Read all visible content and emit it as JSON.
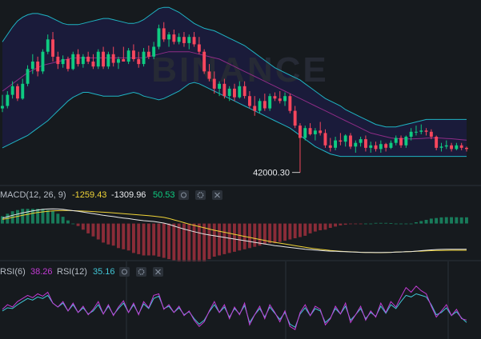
{
  "colors": {
    "background": "#161a1e",
    "up": "#0ecb81",
    "down": "#f6465d",
    "band": "#1fb4c3",
    "band_fill": "#1a1b3a",
    "band_mid": "#8e2c86",
    "macd_line": "#e8e8e8",
    "signal_line": "#f0d437",
    "rsi6": "#c23bd4",
    "rsi12": "#41c6d6",
    "divider": "#2b3139",
    "watermark": "#2a2d3a"
  },
  "watermark": "BINANCE",
  "price_pane": {
    "low_annotation": "42000.30"
  },
  "macd_pane": {
    "title": "MACD(12, 26, 9)",
    "dif": "-1259.43",
    "dea": "-1309.96",
    "hist": "50.53"
  },
  "rsi_pane": {
    "rsi6_label": "RSI(6)",
    "rsi6_value": "38.26",
    "rsi12_label": "RSI(12)",
    "rsi12_value": "35.16"
  },
  "chart_data": {
    "type": "candlestick",
    "note_units": "price in USDT (estimated)",
    "candles": [
      [
        44600,
        45150,
        44450,
        44700
      ],
      [
        44700,
        45300,
        44600,
        45150
      ],
      [
        45150,
        45700,
        45000,
        45500
      ],
      [
        45500,
        45600,
        44900,
        45000
      ],
      [
        45000,
        45800,
        44950,
        45600
      ],
      [
        45600,
        46350,
        45500,
        46200
      ],
      [
        46200,
        46800,
        46000,
        46500
      ],
      [
        46500,
        46700,
        45900,
        46100
      ],
      [
        46100,
        47000,
        46000,
        46900
      ],
      [
        46900,
        47600,
        46800,
        47400
      ],
      [
        47400,
        47700,
        46500,
        46700
      ],
      [
        46700,
        46900,
        46200,
        46400
      ],
      [
        46400,
        46750,
        46250,
        46600
      ],
      [
        46600,
        46700,
        46100,
        46200
      ],
      [
        46200,
        46900,
        46150,
        46800
      ],
      [
        46800,
        47000,
        46300,
        46400
      ],
      [
        46400,
        46800,
        46250,
        46700
      ],
      [
        46700,
        46900,
        46400,
        46500
      ],
      [
        46500,
        46800,
        46200,
        46300
      ],
      [
        46300,
        47000,
        46200,
        46900
      ],
      [
        46900,
        47100,
        46200,
        46300
      ],
      [
        46300,
        46900,
        46200,
        46800
      ],
      [
        46800,
        47100,
        46300,
        46450
      ],
      [
        46450,
        46700,
        46200,
        46600
      ],
      [
        46600,
        47100,
        46500,
        46500
      ],
      [
        46500,
        47050,
        46400,
        46950
      ],
      [
        46950,
        47200,
        46500,
        46600
      ],
      [
        46600,
        46900,
        46250,
        46400
      ],
      [
        46400,
        47050,
        46300,
        46900
      ],
      [
        46900,
        47150,
        46600,
        46700
      ],
      [
        46700,
        47300,
        46600,
        47100
      ],
      [
        47100,
        48000,
        47000,
        47850
      ],
      [
        47850,
        48100,
        47300,
        47400
      ],
      [
        47400,
        47700,
        47100,
        47600
      ],
      [
        47600,
        47800,
        47200,
        47300
      ],
      [
        47300,
        47650,
        47200,
        47500
      ],
      [
        47500,
        47700,
        47100,
        47250
      ],
      [
        47250,
        47600,
        47000,
        47500
      ],
      [
        47500,
        47700,
        47100,
        47200
      ],
      [
        47200,
        47500,
        46800,
        46900
      ],
      [
        46900,
        47000,
        46000,
        46100
      ],
      [
        46100,
        46400,
        45700,
        45800
      ],
      [
        45800,
        46100,
        45200,
        45400
      ],
      [
        45400,
        45700,
        45100,
        45600
      ],
      [
        45600,
        45800,
        45000,
        45100
      ],
      [
        45100,
        45500,
        44900,
        45400
      ],
      [
        45400,
        45600,
        44900,
        45050
      ],
      [
        45050,
        45700,
        45000,
        45500
      ],
      [
        45500,
        45700,
        45000,
        45100
      ],
      [
        45100,
        45300,
        44600,
        44700
      ],
      [
        44700,
        45100,
        44300,
        44500
      ],
      [
        44500,
        45000,
        44400,
        44900
      ],
      [
        44900,
        45200,
        44500,
        44600
      ],
      [
        44600,
        45200,
        44500,
        45100
      ],
      [
        45100,
        45250,
        44900,
        45000
      ],
      [
        45000,
        45300,
        44800,
        44900
      ],
      [
        44900,
        45250,
        44700,
        45100
      ],
      [
        45100,
        45200,
        44400,
        44500
      ],
      [
        44500,
        44700,
        43800,
        43900
      ],
      [
        43900,
        44000,
        42000.3,
        43400
      ],
      [
        43400,
        43900,
        43300,
        43800
      ],
      [
        43800,
        44000,
        43500,
        43550
      ],
      [
        43550,
        43800,
        43300,
        43700
      ],
      [
        43700,
        44050,
        43500,
        43600
      ],
      [
        43600,
        43750,
        43000,
        43100
      ],
      [
        43100,
        43400,
        42850,
        43000
      ],
      [
        43000,
        43450,
        42900,
        43300
      ],
      [
        43300,
        43600,
        43100,
        43250
      ],
      [
        43250,
        43550,
        43050,
        43500
      ],
      [
        43500,
        43600,
        42950,
        43050
      ],
      [
        43050,
        43300,
        42800,
        43200
      ],
      [
        43200,
        43450,
        43050,
        43350
      ],
      [
        43350,
        43500,
        42850,
        43000
      ],
      [
        43000,
        43250,
        42800,
        43100
      ],
      [
        43100,
        43250,
        42850,
        42950
      ],
      [
        42950,
        43300,
        42800,
        43150
      ],
      [
        43150,
        43200,
        42850,
        43000
      ],
      [
        43000,
        43300,
        42950,
        43200
      ],
      [
        43200,
        43500,
        43100,
        43400
      ],
      [
        43400,
        43500,
        43000,
        43100
      ],
      [
        43100,
        43500,
        43000,
        43450
      ],
      [
        43450,
        43800,
        43300,
        43650
      ],
      [
        43650,
        43900,
        43500,
        43650
      ],
      [
        43650,
        43950,
        43550,
        43700
      ],
      [
        43700,
        43800,
        43500,
        43650
      ],
      [
        43650,
        43750,
        43350,
        43450
      ],
      [
        43450,
        43500,
        42900,
        43000
      ],
      [
        43000,
        43200,
        42850,
        43050
      ],
      [
        43050,
        43300,
        42950,
        43100
      ],
      [
        43100,
        43200,
        42850,
        42950
      ],
      [
        42950,
        43200,
        42900,
        43100
      ],
      [
        43100,
        43200,
        42900,
        43000
      ],
      [
        43000,
        43050,
        42850,
        42950
      ]
    ],
    "bollinger": {
      "upper": [
        47300,
        47600,
        47900,
        48150,
        48300,
        48400,
        48450,
        48450,
        48400,
        48350,
        48250,
        48150,
        48050,
        48000,
        48000,
        48000,
        48050,
        48100,
        48150,
        48200,
        48250,
        48250,
        48200,
        48150,
        48100,
        48050,
        48050,
        48100,
        48200,
        48350,
        48500,
        48650,
        48700,
        48700,
        48600,
        48500,
        48350,
        48200,
        48050,
        47950,
        47850,
        47800,
        47750,
        47650,
        47550,
        47450,
        47350,
        47250,
        47150,
        47000,
        46850,
        46700,
        46550,
        46400,
        46250,
        46150,
        46050,
        45950,
        45850,
        45750,
        45600,
        45450,
        45300,
        45150,
        45000,
        44900,
        44800,
        44700,
        44550,
        44450,
        44350,
        44250,
        44150,
        44050,
        43950,
        43900,
        43850,
        43850,
        43850,
        43900,
        43950,
        44000,
        44050,
        44100,
        44150,
        44150,
        44150,
        44150,
        44150,
        44150,
        44150,
        44150,
        44150
      ],
      "mid": [
        45300,
        45450,
        45600,
        45750,
        45900,
        46050,
        46150,
        46250,
        46350,
        46400,
        46450,
        46500,
        46550,
        46600,
        46650,
        46650,
        46650,
        46650,
        46650,
        46650,
        46650,
        46650,
        46650,
        46650,
        46650,
        46650,
        46650,
        46650,
        46650,
        46700,
        46750,
        46800,
        46850,
        46900,
        46900,
        46900,
        46900,
        46900,
        46850,
        46800,
        46750,
        46700,
        46650,
        46600,
        46500,
        46400,
        46300,
        46200,
        46100,
        46000,
        45900,
        45800,
        45700,
        45600,
        45500,
        45400,
        45300,
        45200,
        45100,
        45000,
        44900,
        44800,
        44700,
        44600,
        44500,
        44400,
        44300,
        44200,
        44100,
        44000,
        43900,
        43800,
        43700,
        43600,
        43550,
        43500,
        43450,
        43400,
        43380,
        43370,
        43360,
        43360,
        43370,
        43380,
        43390,
        43400,
        43400,
        43390,
        43380,
        43370,
        43350,
        43330,
        43310
      ],
      "lower": [
        43000,
        43100,
        43200,
        43300,
        43400,
        43500,
        43650,
        43800,
        43950,
        44100,
        44300,
        44500,
        44700,
        44900,
        45050,
        45150,
        45250,
        45250,
        45200,
        45150,
        45100,
        45100,
        45100,
        45100,
        45150,
        45200,
        45250,
        45200,
        45100,
        45050,
        45000,
        44950,
        45000,
        45100,
        45200,
        45300,
        45450,
        45600,
        45650,
        45600,
        45500,
        45400,
        45300,
        45200,
        45100,
        45000,
        44900,
        44800,
        44700,
        44600,
        44500,
        44400,
        44300,
        44200,
        44100,
        44000,
        43900,
        43800,
        43650,
        43500,
        43350,
        43200,
        43050,
        42950,
        42850,
        42750,
        42700,
        42650,
        42650,
        42650,
        42650,
        42650,
        42650,
        42650,
        42650,
        42650,
        42650,
        42650,
        42650,
        42650,
        42650,
        42650,
        42650,
        42650,
        42650,
        42650,
        42650,
        42650,
        42650,
        42650,
        42650,
        42650,
        42650
      ]
    },
    "ylim": [
      41600,
      49000
    ],
    "macd": {
      "dif": [
        260,
        330,
        400,
        460,
        520,
        570,
        620,
        660,
        690,
        710,
        720,
        710,
        690,
        660,
        630,
        600,
        560,
        520,
        480,
        440,
        400,
        370,
        340,
        300,
        270,
        240,
        200,
        170,
        140,
        120,
        100,
        60,
        20,
        -40,
        -120,
        -200,
        -270,
        -340,
        -400,
        -460,
        -520,
        -560,
        -600,
        -640,
        -680,
        -720,
        -760,
        -800,
        -840,
        -880,
        -920,
        -960,
        -1000,
        -1040,
        -1080,
        -1110,
        -1140,
        -1170,
        -1200,
        -1230,
        -1260,
        -1280,
        -1300,
        -1320,
        -1340,
        -1350,
        -1360,
        -1370,
        -1380,
        -1390,
        -1400,
        -1410,
        -1415,
        -1420,
        -1420,
        -1420,
        -1415,
        -1410,
        -1400,
        -1390,
        -1380,
        -1370,
        -1350,
        -1330,
        -1310,
        -1290,
        -1275,
        -1265,
        -1260,
        -1258,
        -1259,
        -1260,
        -1259.43
      ],
      "dea": [
        200,
        250,
        300,
        350,
        400,
        450,
        500,
        540,
        570,
        600,
        620,
        630,
        635,
        635,
        630,
        620,
        610,
        600,
        585,
        570,
        555,
        540,
        520,
        500,
        480,
        460,
        440,
        420,
        400,
        380,
        360,
        330,
        300,
        250,
        180,
        110,
        40,
        -30,
        -90,
        -150,
        -210,
        -270,
        -330,
        -380,
        -430,
        -480,
        -530,
        -580,
        -630,
        -680,
        -730,
        -780,
        -830,
        -880,
        -920,
        -960,
        -1000,
        -1040,
        -1080,
        -1120,
        -1160,
        -1200,
        -1235,
        -1265,
        -1290,
        -1315,
        -1335,
        -1355,
        -1370,
        -1385,
        -1395,
        -1405,
        -1415,
        -1420,
        -1425,
        -1425,
        -1420,
        -1412,
        -1400,
        -1390,
        -1380,
        -1370,
        -1360,
        -1350,
        -1340,
        -1330,
        -1320,
        -1315,
        -1312,
        -1310,
        -1310,
        -1310,
        -1309.96
      ],
      "hist": [
        60,
        80,
        100,
        110,
        120,
        120,
        120,
        120,
        120,
        110,
        100,
        80,
        55,
        25,
        0,
        -20,
        -50,
        -80,
        -105,
        -130,
        -155,
        -170,
        -180,
        -200,
        -210,
        -220,
        -240,
        -250,
        -260,
        -260,
        -260,
        -270,
        -280,
        -290,
        -300,
        -310,
        -310,
        -310,
        -310,
        -310,
        -310,
        -290,
        -270,
        -260,
        -250,
        -240,
        -230,
        -220,
        -210,
        -200,
        -190,
        -180,
        -170,
        -160,
        -160,
        -150,
        -140,
        -130,
        -120,
        -110,
        -100,
        -80,
        -65,
        -55,
        -50,
        -35,
        -25,
        -15,
        -10,
        -5,
        -5,
        -5,
        0,
        0,
        5,
        5,
        5,
        2,
        0,
        0,
        0,
        0,
        10,
        20,
        30,
        40,
        45,
        50,
        52,
        52,
        51,
        50,
        50.53
      ],
      "ylim": [
        -1700,
        1000
      ]
    },
    "rsi": {
      "rsi6": [
        52,
        58,
        55,
        62,
        66,
        70,
        67,
        72,
        69,
        74,
        60,
        55,
        62,
        50,
        60,
        48,
        56,
        45,
        52,
        62,
        46,
        58,
        44,
        55,
        63,
        48,
        60,
        45,
        62,
        54,
        70,
        72,
        52,
        58,
        48,
        56,
        44,
        50,
        38,
        30,
        36,
        50,
        62,
        48,
        58,
        40,
        55,
        45,
        60,
        32,
        45,
        56,
        40,
        58,
        48,
        36,
        50,
        30,
        26,
        48,
        58,
        44,
        56,
        52,
        32,
        40,
        56,
        46,
        60,
        35,
        45,
        56,
        38,
        50,
        42,
        60,
        48,
        62,
        55,
        68,
        80,
        74,
        82,
        76,
        72,
        56,
        42,
        50,
        58,
        44,
        52,
        40,
        38.26
      ],
      "rsi12": [
        50,
        54,
        53,
        58,
        62,
        66,
        64,
        68,
        66,
        70,
        60,
        55,
        60,
        50,
        58,
        48,
        54,
        46,
        50,
        58,
        46,
        56,
        45,
        53,
        60,
        48,
        58,
        46,
        59,
        53,
        66,
        69,
        53,
        56,
        48,
        54,
        45,
        49,
        40,
        33,
        38,
        49,
        58,
        48,
        55,
        42,
        53,
        46,
        57,
        35,
        45,
        53,
        42,
        55,
        47,
        39,
        48,
        33,
        29,
        46,
        54,
        44,
        53,
        50,
        35,
        41,
        53,
        46,
        56,
        38,
        45,
        53,
        40,
        48,
        43,
        56,
        47,
        58,
        53,
        62,
        70,
        68,
        72,
        70,
        68,
        58,
        45,
        48,
        54,
        44,
        49,
        41,
        35.16
      ],
      "ylim": [
        0,
        100
      ]
    }
  }
}
